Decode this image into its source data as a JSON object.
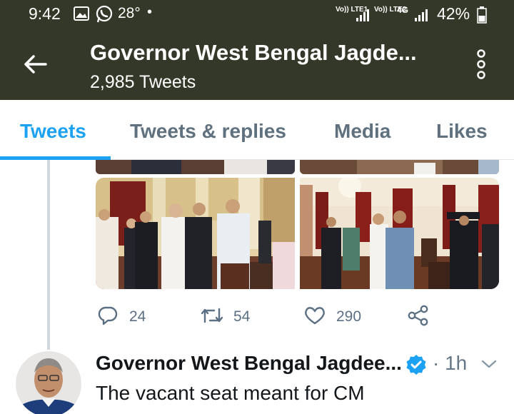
{
  "status_bar": {
    "time": "9:42",
    "temperature": "28°",
    "sim1": "Vo)) LTE1",
    "sim2": "Vo)) LTE2",
    "network_type": "4G",
    "battery": "42%",
    "icons": [
      "gallery-icon",
      "whatsapp-icon",
      "signal-icon",
      "battery-icon"
    ]
  },
  "header": {
    "title": "Governor West Bengal Jagde...",
    "subtitle": "2,985 Tweets",
    "icons": [
      "back-arrow-icon",
      "more-vertical-icon"
    ]
  },
  "tabs": [
    {
      "label": "Tweets",
      "active": true
    },
    {
      "label": "Tweets & replies",
      "active": false
    },
    {
      "label": "Media",
      "active": false
    },
    {
      "label": "Likes",
      "active": false
    }
  ],
  "tweet1": {
    "actions": {
      "reply": "24",
      "retweet": "54",
      "like": "290"
    },
    "icons": [
      "reply-icon",
      "retweet-icon",
      "heart-icon",
      "share-icon"
    ]
  },
  "tweet2": {
    "name": "Governor West Bengal Jagdee...",
    "time": "· 1h",
    "text": "The vacant seat meant for CM",
    "icons": [
      "verified-badge-icon",
      "chevron-down-icon"
    ]
  },
  "colors": {
    "header_bg": "#343828",
    "accent": "#1da1f2",
    "muted": "#5b7083"
  }
}
